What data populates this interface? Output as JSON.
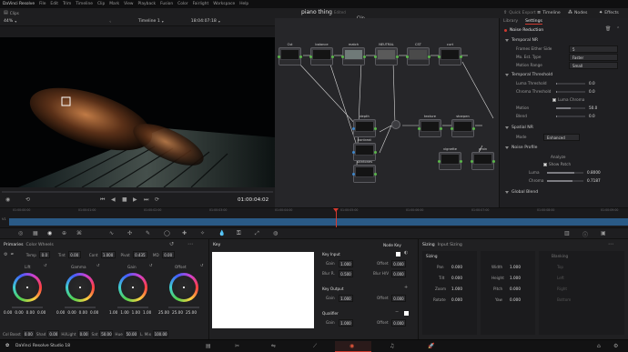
{
  "menubar": {
    "app": "DaVinci Resolve",
    "items": [
      "File",
      "Edit",
      "Trim",
      "Timeline",
      "Clip",
      "Mark",
      "View",
      "Playback",
      "Fusion",
      "Color",
      "Fairlight",
      "Workspace",
      "Help"
    ]
  },
  "project": {
    "title": "piano thing",
    "saved": "Edited"
  },
  "header_tabs": {
    "quick_export": "Quick Export",
    "timeline": "Timeline",
    "nodes": "Nodes",
    "effects": "Effects",
    "clips": "Clips",
    "clip_mode": "Clip"
  },
  "viewer": {
    "zoom": "44%",
    "timeline_name": "Timeline 1",
    "timecode_top": "18:04:07:18",
    "timecode": "01:00:04:02"
  },
  "nodes": [
    {
      "id": "1",
      "label": "Cst"
    },
    {
      "id": "2",
      "label": "balance"
    },
    {
      "id": "3",
      "label": "match"
    },
    {
      "id": "4",
      "label": "NEUTRAL"
    },
    {
      "id": "5",
      "label": "CST"
    },
    {
      "id": "6",
      "label": "curt"
    },
    {
      "id": "7",
      "label": "depth"
    },
    {
      "id": "8",
      "label": "contrast"
    },
    {
      "id": "9",
      "label": "skintones"
    },
    {
      "id": "10",
      "label": "texture"
    },
    {
      "id": "11",
      "label": "sharpen"
    },
    {
      "id": "12",
      "label": "vignette"
    },
    {
      "id": "13",
      "label": "grain"
    }
  ],
  "inspector": {
    "tabs": [
      "Library",
      "Settings"
    ],
    "effect_name": "Noise Reduction",
    "temporal_nr": "Temporal NR",
    "frames_either_side_label": "Frames Either Side",
    "frames_either_side": "5",
    "mo_est_type_label": "Mo. Est. Type",
    "mo_est_type": "Faster",
    "motion_range_label": "Motion Range",
    "motion_range": "Small",
    "temporal_threshold": "Temporal Threshold",
    "luma_threshold_label": "Luma Threshold",
    "luma_threshold": "0.0",
    "chroma_threshold_label": "Chroma Threshold",
    "chroma_threshold": "0.0",
    "lock_label": "Luma Chroma",
    "motion_label": "Motion",
    "motion": "50.0",
    "blend_label": "Blend",
    "blend": "0.0",
    "spatial_nr": "Spatial NR",
    "mode_label": "Mode",
    "mode": "Enhanced",
    "noise_profile": "Noise Profile",
    "analyze": "Analyze",
    "show_patch": "Show Patch",
    "luma_label": "Luma",
    "luma": "0.8000",
    "chroma_label": "Chroma",
    "chroma": "0.7187",
    "global_blend": "Global Blend"
  },
  "mini_timeline": {
    "ticks": [
      "01:00:00:00",
      "01:00:01:00",
      "01:00:02:00",
      "01:00:03:00",
      "01:00:04:00",
      "01:00:05:00",
      "01:00:06:00",
      "01:00:07:00",
      "01:00:08:00",
      "01:00:09:00"
    ],
    "track": "V1"
  },
  "primaries": {
    "title": "Primaries",
    "mode": "Color Wheels",
    "temp_label": "Temp",
    "temp": "0.0",
    "tint_label": "Tint",
    "tint": "0.00",
    "contrast_label": "Cont",
    "contrast": "1.000",
    "pivot_label": "Pivot",
    "pivot": "0.435",
    "md_label": "MD",
    "md": "0.00",
    "wheels": [
      {
        "name": "Lift",
        "values": [
          "0.00",
          "0.00",
          "0.00",
          "0.00"
        ]
      },
      {
        "name": "Gamma",
        "values": [
          "0.00",
          "0.00",
          "0.00",
          "0.00"
        ]
      },
      {
        "name": "Gain",
        "values": [
          "1.00",
          "1.00",
          "1.00",
          "1.00"
        ]
      },
      {
        "name": "Offset",
        "values": [
          "25.00",
          "25.00",
          "25.00"
        ]
      }
    ],
    "bottom": {
      "col_boost_label": "Col Boost",
      "col_boost": "0.00",
      "shad_label": "Shad",
      "shad": "0.00",
      "hi_light_label": "Hi/Light",
      "hi_light": "0.00",
      "sat_label": "Sat",
      "sat": "50.00",
      "hue_label": "Hue",
      "hue": "50.00",
      "lum_mix_label": "L. Mix",
      "lum_mix": "100.00"
    }
  },
  "key": {
    "title": "Key",
    "node_key": "Node Key",
    "key_input": "Key Input",
    "gain_label": "Gain",
    "gain": "1.000",
    "offset_label": "Offset",
    "offset": "0.000",
    "blur_r_label": "Blur R.",
    "blur_r": "0.500",
    "blur_h_label": "Blur H/V",
    "blur_h": "0.000",
    "key_output": "Key Output",
    "out_gain": "1.000",
    "out_offset": "0.000",
    "qualifier": "Qualifier",
    "q_gain": "1.000",
    "q_offset": "0.000"
  },
  "sizing": {
    "title": "Sizing",
    "mode": "Input Sizing",
    "subtitle": "Sizing",
    "left": [
      {
        "label": "Pan",
        "value": "0.000"
      },
      {
        "label": "Tilt",
        "value": "0.000"
      },
      {
        "label": "Zoom",
        "value": "1.000"
      },
      {
        "label": "Rotate",
        "value": "0.000"
      }
    ],
    "mid": [
      {
        "label": "Width",
        "value": "1.000"
      },
      {
        "label": "Height",
        "value": "1.000"
      },
      {
        "label": "Pitch",
        "value": "0.000"
      },
      {
        "label": "Yaw",
        "value": "0.000"
      }
    ],
    "blanking": "Blanking",
    "blank_labels": [
      "Top",
      "Left",
      "Right",
      "Bottom"
    ]
  },
  "footer": {
    "app": "DaVinci Resolve Studio 18",
    "pages": [
      "media-icon",
      "cut-icon",
      "edit-icon",
      "fusion-icon",
      "color-icon",
      "fairlight-icon",
      "deliver-icon"
    ]
  }
}
